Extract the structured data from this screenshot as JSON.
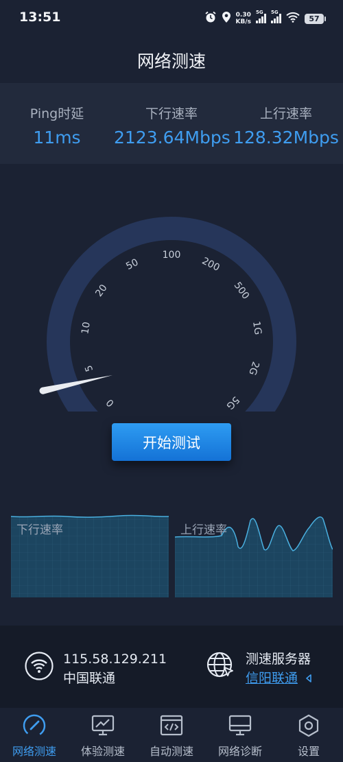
{
  "status_bar": {
    "time": "13:51",
    "net_speed_value": "0.30",
    "net_speed_unit": "KB/s",
    "sim1_label": "5G",
    "sim2_label": "5G",
    "battery": "57"
  },
  "page_title": "网络测速",
  "stats": {
    "ping": {
      "label": "Ping时延",
      "value": "11ms"
    },
    "download": {
      "label": "下行速率",
      "value": "2123.64Mbps"
    },
    "upload": {
      "label": "上行速率",
      "value": "128.32Mbps"
    }
  },
  "gauge": {
    "scale_labels": [
      "0",
      "5",
      "10",
      "20",
      "50",
      "100",
      "200",
      "500",
      "1G",
      "2G",
      "5G"
    ],
    "needle_fraction": 0.12
  },
  "start_button_label": "开始测试",
  "charts": {
    "download_label": "下行速率",
    "upload_label": "上行速率"
  },
  "network_info": {
    "ip": "115.58.129.211",
    "isp": "中国联通",
    "server_title": "测速服务器",
    "server_name": "信阳联通"
  },
  "tabs": [
    {
      "label": "网络测速",
      "icon": "speedometer-icon",
      "active": true
    },
    {
      "label": "体验测速",
      "icon": "monitor-chart-icon",
      "active": false
    },
    {
      "label": "自动测速",
      "icon": "code-window-icon",
      "active": false
    },
    {
      "label": "网络诊断",
      "icon": "monitor-icon",
      "active": false
    },
    {
      "label": "设置",
      "icon": "settings-hex-icon",
      "active": false
    }
  ],
  "colors": {
    "accent": "#3f9df0",
    "background": "#1b2233",
    "panel": "#222a3c",
    "gauge_track": "#26365a"
  }
}
